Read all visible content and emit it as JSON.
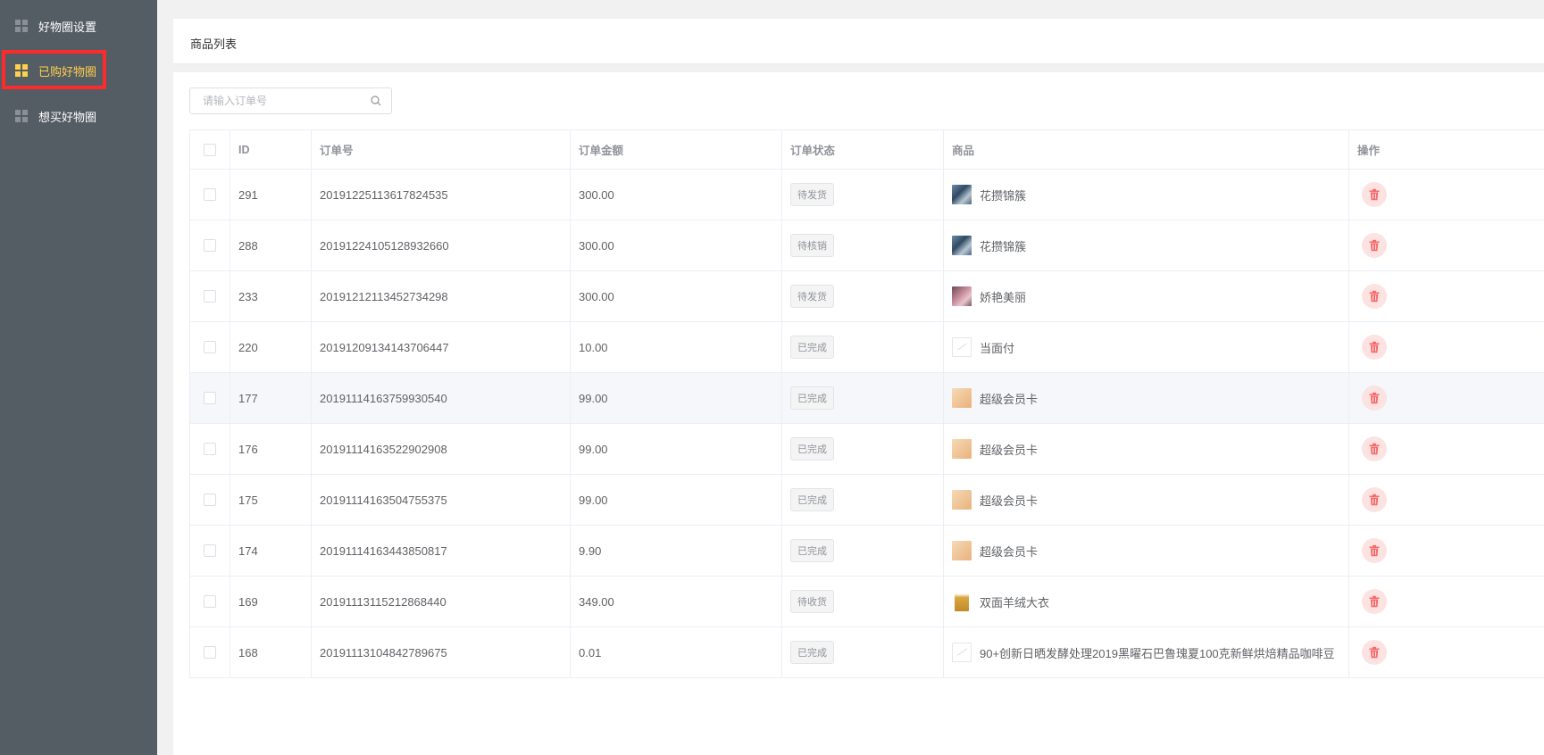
{
  "sidebar": {
    "items": [
      {
        "label": "好物圈设置",
        "active": false,
        "icon": "grid-icon"
      },
      {
        "label": "已购好物圈",
        "active": true,
        "icon": "grid-icon"
      },
      {
        "label": "想买好物圈",
        "active": false,
        "icon": "grid-icon"
      }
    ],
    "active_color": "#ffd04b",
    "background": "#545c64"
  },
  "header": {
    "title": "商品列表"
  },
  "search": {
    "placeholder": "请输入订单号",
    "value": ""
  },
  "table": {
    "columns": [
      "",
      "ID",
      "订单号",
      "订单金额",
      "订单状态",
      "商品",
      "操作"
    ],
    "rows": [
      {
        "id": "291",
        "order_no": "20191225113617824535",
        "amount": "300.00",
        "status": "待发货",
        "product": "花攒锦簇",
        "thumb": "flower-blue"
      },
      {
        "id": "288",
        "order_no": "20191224105128932660",
        "amount": "300.00",
        "status": "待核销",
        "product": "花攒锦簇",
        "thumb": "flower-blue"
      },
      {
        "id": "233",
        "order_no": "20191212113452734298",
        "amount": "300.00",
        "status": "待发货",
        "product": "娇艳美丽",
        "thumb": "flower-pink"
      },
      {
        "id": "220",
        "order_no": "20191209134143706447",
        "amount": "10.00",
        "status": "已完成",
        "product": "当面付",
        "thumb": "placeholder"
      },
      {
        "id": "177",
        "order_no": "20191114163759930540",
        "amount": "99.00",
        "status": "已完成",
        "product": "超级会员卡",
        "thumb": "card-gold",
        "hover": true
      },
      {
        "id": "176",
        "order_no": "20191114163522902908",
        "amount": "99.00",
        "status": "已完成",
        "product": "超级会员卡",
        "thumb": "card-gold"
      },
      {
        "id": "175",
        "order_no": "20191114163504755375",
        "amount": "99.00",
        "status": "已完成",
        "product": "超级会员卡",
        "thumb": "card-gold"
      },
      {
        "id": "174",
        "order_no": "20191114163443850817",
        "amount": "9.90",
        "status": "已完成",
        "product": "超级会员卡",
        "thumb": "card-gold"
      },
      {
        "id": "169",
        "order_no": "20191113115212868440",
        "amount": "349.00",
        "status": "待收货",
        "product": "双面羊绒大衣",
        "thumb": "coat"
      },
      {
        "id": "168",
        "order_no": "20191113104842789675",
        "amount": "0.01",
        "status": "已完成",
        "product": "90+创新日晒发酵处理2019黑曜石巴鲁瑰夏100克新鲜烘焙精品咖啡豆",
        "thumb": "placeholder"
      }
    ]
  },
  "colors": {
    "delete_bg": "#fde2e2",
    "delete_icon": "#f56c6c",
    "highlight_box": "#ff2a2a"
  }
}
